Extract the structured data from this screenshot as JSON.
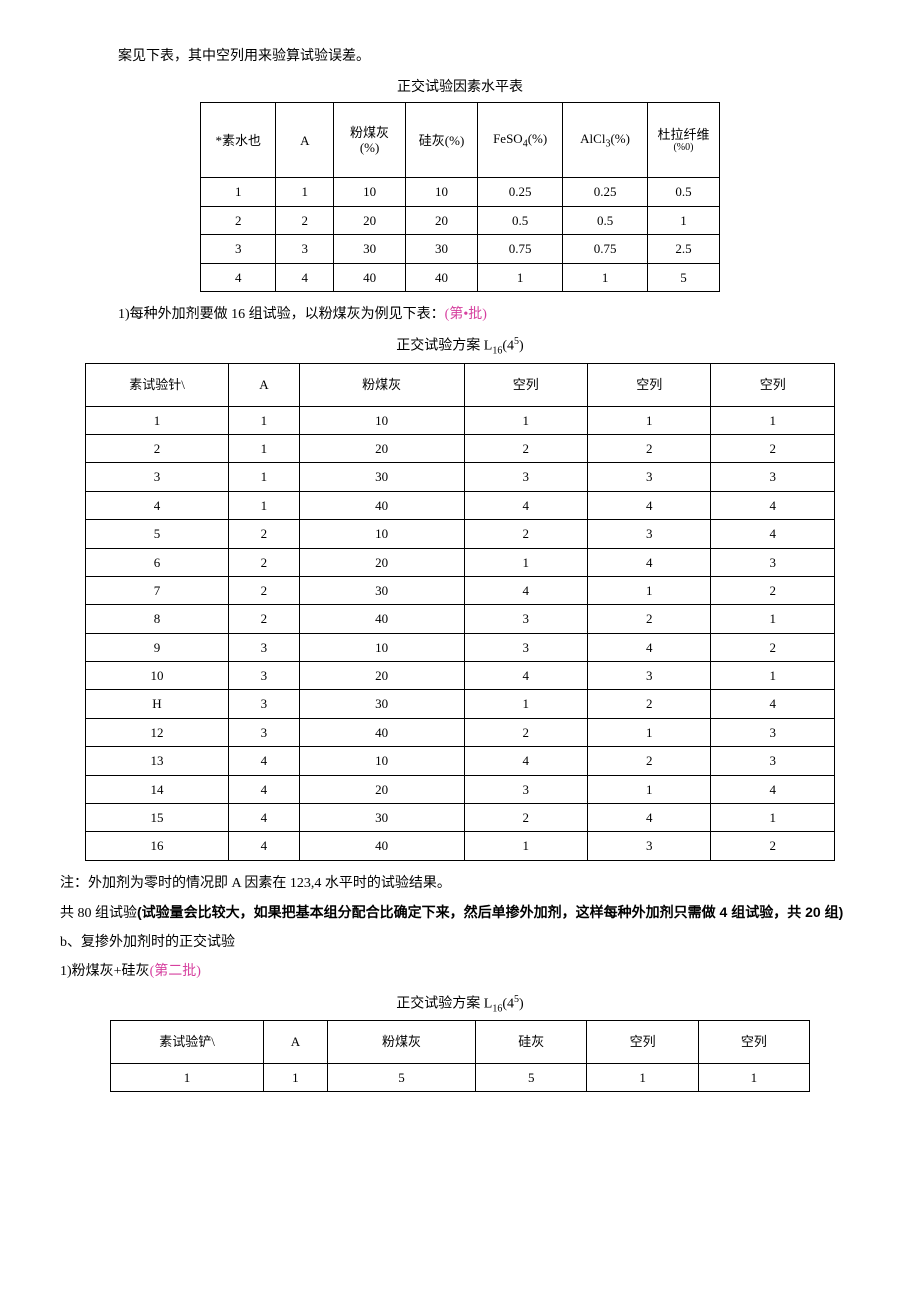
{
  "intro": "案见下表，其中空列用来验算试验误差。",
  "table1": {
    "caption": "正交试验因素水平表",
    "headers": [
      "*素水也",
      "A",
      "粉煤灰(%)",
      "硅灰(%)",
      "FeSO4(%)",
      "AlCl3(%)",
      "杜拉纤维(%0)"
    ],
    "h3_top": "粉煤灰",
    "h3_bot": "(%)",
    "h7_top": "杜拉纤维",
    "h7_bot": "(%0)",
    "rows": [
      [
        "1",
        "1",
        "10",
        "10",
        "0.25",
        "0.25",
        "0.5"
      ],
      [
        "2",
        "2",
        "20",
        "20",
        "0.5",
        "0.5",
        "1"
      ],
      [
        "3",
        "3",
        "30",
        "30",
        "0.75",
        "0.75",
        "2.5"
      ],
      [
        "4",
        "4",
        "40",
        "40",
        "1",
        "1",
        "5"
      ]
    ]
  },
  "section1": {
    "prefix": "1)每种外加剂要做 16 组试验，以粉煤灰为例见下表：",
    "note_pink": "(第•批)"
  },
  "table2": {
    "caption_prefix": "正交试验方案 L",
    "caption_sub": "16",
    "caption_paren": "(4",
    "caption_sup": "5",
    "caption_close": ")",
    "headers": [
      "素试验针\\",
      "A",
      "粉煤灰",
      "空列",
      "空列",
      "空列"
    ],
    "rows": [
      [
        "1",
        "1",
        "10",
        "1",
        "1",
        "1"
      ],
      [
        "2",
        "1",
        "20",
        "2",
        "2",
        "2"
      ],
      [
        "3",
        "1",
        "30",
        "3",
        "3",
        "3"
      ],
      [
        "4",
        "1",
        "40",
        "4",
        "4",
        "4"
      ],
      [
        "5",
        "2",
        "10",
        "2",
        "3",
        "4"
      ],
      [
        "6",
        "2",
        "20",
        "1",
        "4",
        "3"
      ],
      [
        "7",
        "2",
        "30",
        "4",
        "1",
        "2"
      ],
      [
        "8",
        "2",
        "40",
        "3",
        "2",
        "1"
      ],
      [
        "9",
        "3",
        "10",
        "3",
        "4",
        "2"
      ],
      [
        "10",
        "3",
        "20",
        "4",
        "3",
        "1"
      ],
      [
        "H",
        "3",
        "30",
        "1",
        "2",
        "4"
      ],
      [
        "12",
        "3",
        "40",
        "2",
        "1",
        "3"
      ],
      [
        "13",
        "4",
        "10",
        "4",
        "2",
        "3"
      ],
      [
        "14",
        "4",
        "20",
        "3",
        "1",
        "4"
      ],
      [
        "15",
        "4",
        "30",
        "2",
        "4",
        "1"
      ],
      [
        "16",
        "4",
        "40",
        "1",
        "3",
        "2"
      ]
    ]
  },
  "notes": {
    "n1": "注：外加剂为零时的情况即 A 因素在 123,4 水平时的试验结果。",
    "n2a": "共 80 组试验",
    "n2b": "(试验量会比较大，如果把基本组分配合比确定下来，然后单掺外加剂，这样每种外加剂只需做 4 组试验，共 20 组)",
    "n3": "b、复掺外加剂时的正交试验",
    "n4a": "1)粉煤灰+硅灰",
    "n4b": "(第二批)"
  },
  "table3": {
    "caption_prefix": "正交试验方案 L",
    "caption_sub": "16",
    "caption_paren": "(4",
    "caption_sup": "5",
    "caption_close": ")",
    "headers": [
      "素试验铲\\",
      "A",
      "粉煤灰",
      "硅灰",
      "空列",
      "空列"
    ],
    "rows": [
      [
        "1",
        "1",
        "5",
        "5",
        "1",
        "1"
      ]
    ]
  },
  "formula": {
    "feso4": "FeSO",
    "feso4_sub": "4",
    "alcl3": "AlCl",
    "alcl3_sub": "3"
  }
}
